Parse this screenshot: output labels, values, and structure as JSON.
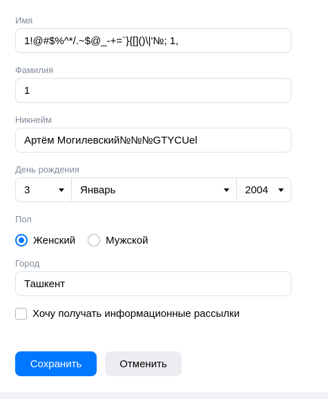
{
  "form": {
    "first_name": {
      "label": "Имя",
      "value": "1!@#$%^*/.~$@_-+=`}{[]()\\|'№; 1,"
    },
    "last_name": {
      "label": "Фамилия",
      "value": "1"
    },
    "nickname": {
      "label": "Никнейм",
      "value": "Артём Могилевский№№№GTYCUel"
    },
    "birthday": {
      "label": "День рождения",
      "day": "3",
      "month": "Январь",
      "year": "2004"
    },
    "gender": {
      "label": "Пол",
      "options": [
        {
          "label": "Женский",
          "checked": true
        },
        {
          "label": "Мужской",
          "checked": false
        }
      ]
    },
    "city": {
      "label": "Город",
      "value": "Ташкент"
    },
    "newsletter": {
      "label": "Хочу получать информационные рассылки",
      "checked": false
    }
  },
  "buttons": {
    "save_label": "Сохранить",
    "cancel_label": "Отменить"
  },
  "colors": {
    "accent": "#0077ff",
    "label": "#818c99",
    "border": "#dce1e6",
    "secondary_button": "#ebedf0"
  }
}
